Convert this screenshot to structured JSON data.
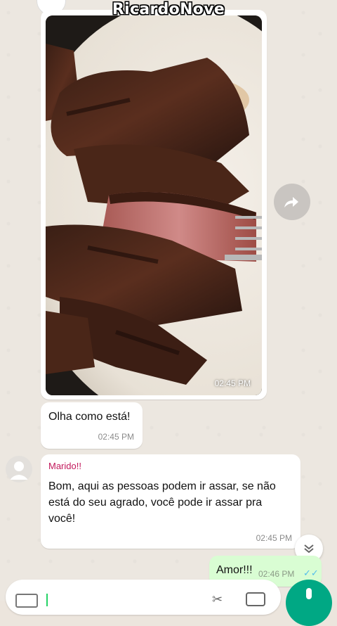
{
  "watermark": "RicardoNove",
  "messages": {
    "image": {
      "time": "02:45 PM"
    },
    "first": {
      "text": "Olha como está!",
      "time": "02:45 PM"
    },
    "second": {
      "sender": "Marido!!",
      "text": "Bom, aqui as pessoas podem ir assar, se não está do seu agrado, você pode ir assar pra você!",
      "time": "02:45 PM"
    },
    "outgoing": {
      "text": "Amor!!!",
      "time": "02:46 PM",
      "ticks": "✓✓"
    }
  },
  "colors": {
    "sender_name": "#c2185b",
    "outgoing_bubble": "#d9fdd3",
    "accent": "#00a884",
    "read_ticks": "#53bdeb"
  },
  "icons": [
    "forward-icon",
    "chevrons-down-icon",
    "keyboard-icon",
    "attach-icon",
    "camera-icon",
    "mic-icon",
    "user-avatar-icon"
  ]
}
